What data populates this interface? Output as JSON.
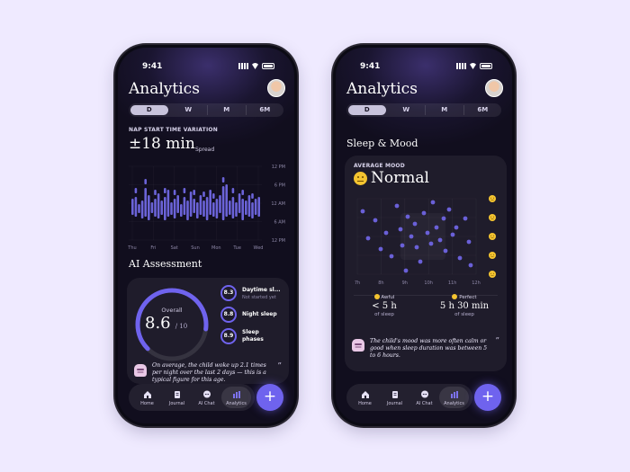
{
  "colors": {
    "accent": "#6f63ee",
    "bar": "#6b63d8",
    "dot": "#6a60d8"
  },
  "left": {
    "status": {
      "time": "9:41"
    },
    "title": "Analytics",
    "segments": [
      "D",
      "W",
      "M",
      "6M"
    ],
    "active_segment": "D",
    "metric": {
      "label": "NAP START TIME VARIATION",
      "value": "±18 min",
      "unit": "Spread"
    },
    "chart_data": {
      "type": "bar",
      "categories": [
        "Thu",
        "Fri",
        "Sat",
        "Sun",
        "Mon",
        "Tue",
        "Wed"
      ],
      "y_ticks": [
        "12 PM",
        "6 PM",
        "12 AM",
        "6 AM",
        "12 PM"
      ]
    },
    "assessment": {
      "title": "AI Assessment",
      "overall_label": "Overall",
      "overall_value": "8.6",
      "overall_max": "/ 10",
      "overall_fraction": 0.86,
      "items": [
        {
          "score": "8.3",
          "label": "Daytime sl...",
          "sub": "Not started yet"
        },
        {
          "score": "8.8",
          "label": "Night sleep",
          "sub": ""
        },
        {
          "score": "8.9",
          "label": "Sleep phases",
          "sub": ""
        }
      ],
      "quote": "On average, the child woke up 2.1 times per night over the last 2 days — this is a typical figure for this age."
    },
    "nav": [
      {
        "label": "Home",
        "icon": "home-icon"
      },
      {
        "label": "Journal",
        "icon": "journal-icon"
      },
      {
        "label": "AI Chat",
        "icon": "chat-icon"
      },
      {
        "label": "Analytics",
        "icon": "analytics-icon"
      }
    ],
    "active_nav": "Analytics",
    "fab": "+"
  },
  "right": {
    "status": {
      "time": "9:41"
    },
    "title": "Analytics",
    "segments": [
      "D",
      "W",
      "M",
      "6M"
    ],
    "active_segment": "D",
    "section_title": "Sleep & Mood",
    "mood": {
      "label": "AVERAGE MOOD",
      "value": "Normal"
    },
    "chart_data": {
      "type": "scatter",
      "x_ticks": [
        "7h",
        "8h",
        "9h",
        "10h",
        "11h",
        "12h"
      ],
      "y_labels": [
        "awful",
        "bad",
        "normal",
        "good",
        "perfect"
      ]
    },
    "range": {
      "awful_label": "Awful",
      "awful_value": "< 5 h",
      "awful_sub": "of sleep",
      "perfect_label": "Perfect",
      "perfect_value": "5 h 30 min",
      "perfect_sub": "of sleep"
    },
    "quote": "The child's mood was more often calm or good when sleep duration was between 5 to 6 hours.",
    "nav": [
      {
        "label": "Home",
        "icon": "home-icon"
      },
      {
        "label": "Journal",
        "icon": "journal-icon"
      },
      {
        "label": "AI Chat",
        "icon": "chat-icon"
      },
      {
        "label": "Analytics",
        "icon": "analytics-icon"
      }
    ],
    "active_nav": "Analytics",
    "fab": "+"
  }
}
